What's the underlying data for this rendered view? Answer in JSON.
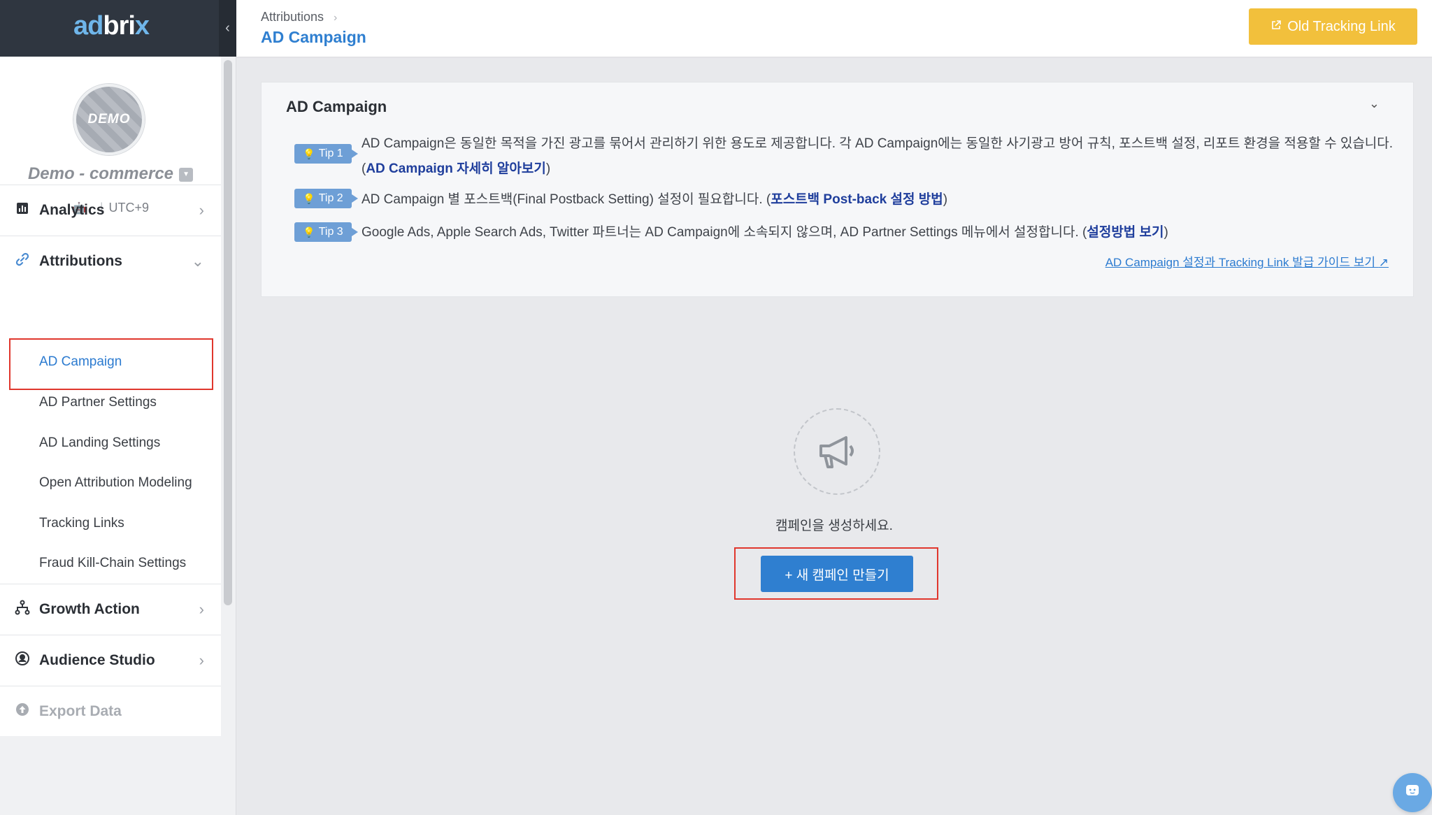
{
  "sidebar": {
    "logo": {
      "part1": "ad",
      "part2": "bri",
      "part3": "x"
    },
    "collapse_icon": "‹",
    "avatar_label": "DEMO",
    "app_name": "Demo - commerce",
    "timezone": "UTC+9",
    "nav": {
      "analytics": "Analytics",
      "attributions": "Attributions",
      "growth_action": "Growth Action",
      "audience_studio": "Audience Studio",
      "export_data": "Export Data"
    },
    "attributions_sub": [
      "AD Campaign",
      "AD Partner Settings",
      "AD Landing Settings",
      "Open Attribution Modeling",
      "Tracking Links",
      "Fraud Kill-Chain Settings"
    ]
  },
  "header": {
    "breadcrumb": "Attributions",
    "title": "AD Campaign",
    "old_tracking_link": "Old Tracking Link"
  },
  "info_card": {
    "title": "AD Campaign",
    "tips": [
      {
        "badge": "Tip 1",
        "text": "AD Campaign은 동일한 목적을 가진 광고를 묶어서 관리하기 위한 용도로 제공합니다. 각 AD Campaign에는 동일한 사기광고 방어 규칙, 포스트백 설정, 리포트 환경을 적용할 수 있습니다.",
        "link": "AD Campaign 자세히 알아보기"
      },
      {
        "badge": "Tip 2",
        "text": "AD Campaign 별 포스트백(Final Postback Setting) 설정이 필요합니다.",
        "link": "포스트백 Post-back 설정 방법"
      },
      {
        "badge": "Tip 3",
        "text": "Google Ads, Apple Search Ads, Twitter 파트너는 AD Campaign에 소속되지 않으며, AD Partner Settings 메뉴에서 설정합니다.",
        "link": "설정방법 보기"
      }
    ],
    "guide_link": "AD Campaign 설정과 Tracking Link 발급 가이드 보기"
  },
  "empty_state": {
    "icon": "megaphone-icon",
    "message": "캠페인을 생성하세요.",
    "button": "+ 새 캠페인 만들기"
  },
  "colors": {
    "accent": "#2f7fd0",
    "warning_button": "#f2c03c",
    "tip_badge": "#6e9fd6",
    "highlight_outline": "#e0372d",
    "logo_dark": "#2f3640"
  }
}
